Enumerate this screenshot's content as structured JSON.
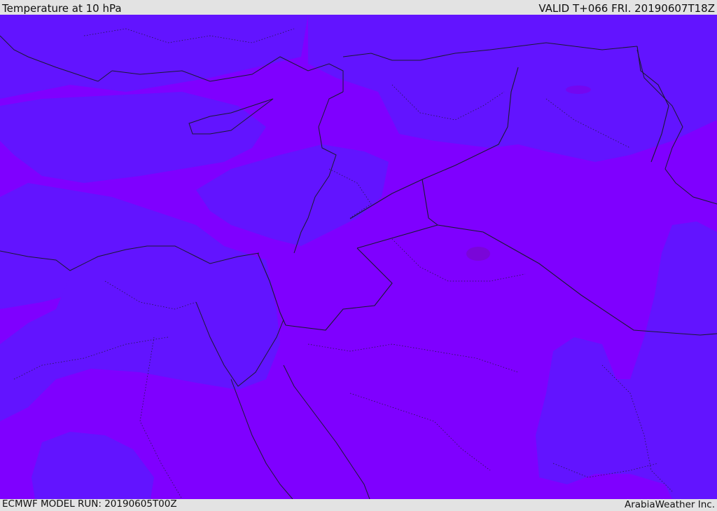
{
  "header": {
    "title": "Temperature at 10 hPa",
    "valid_time": "VALID T+066 FRI. 20190607T18Z"
  },
  "footer": {
    "model_run": "ECMWF MODEL RUN: 20190605T00Z",
    "credit": "ArabiaWeather Inc."
  },
  "map": {
    "colors": {
      "background": "#7f00ff",
      "cool_band": "#6214ff",
      "warm_spot": "#7a06d8",
      "boundary": "#1a1a33"
    },
    "legend_visible": false
  }
}
